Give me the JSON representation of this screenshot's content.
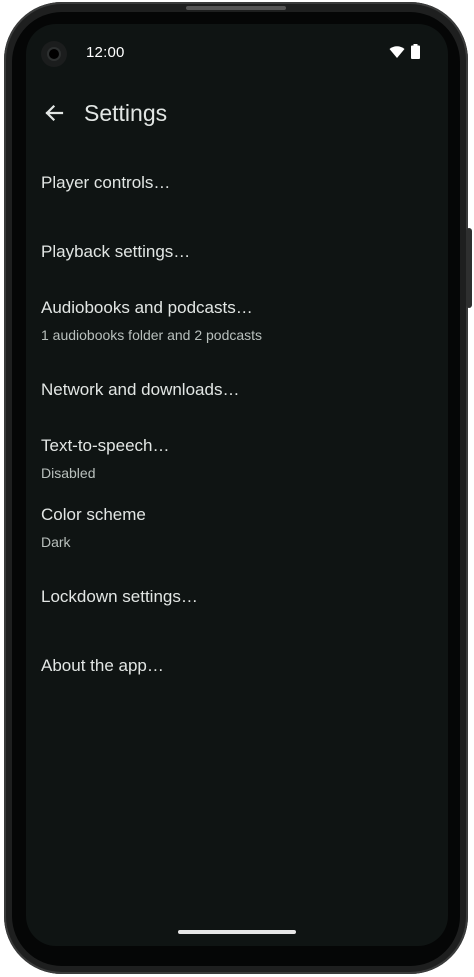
{
  "status_bar": {
    "time": "12:00",
    "icons": [
      "wifi-icon",
      "battery-icon"
    ]
  },
  "app_bar": {
    "title": "Settings",
    "back_icon": "arrow-back-icon"
  },
  "settings": [
    {
      "title": "Player controls…",
      "summary": ""
    },
    {
      "title": "Playback settings…",
      "summary": ""
    },
    {
      "title": "Audiobooks and podcasts…",
      "summary": "1 audiobooks folder and 2 podcasts"
    },
    {
      "title": "Network and downloads…",
      "summary": ""
    },
    {
      "title": "Text-to-speech…",
      "summary": "Disabled"
    },
    {
      "title": "Color scheme",
      "summary": "Dark"
    },
    {
      "title": "Lockdown settings…",
      "summary": ""
    },
    {
      "title": "About the app…",
      "summary": ""
    }
  ],
  "colors": {
    "background": "#0f1413",
    "text_primary": "#e2e6e4",
    "text_secondary": "#b9c0bd"
  }
}
